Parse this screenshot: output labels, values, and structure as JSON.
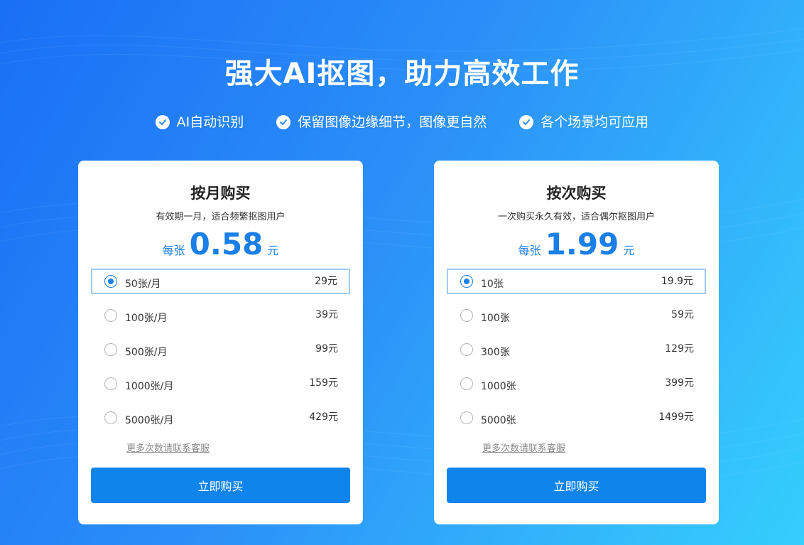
{
  "headline": "强大AI抠图，助力高效工作",
  "features": [
    {
      "icon": "check-circle-icon",
      "label": "AI自动识别"
    },
    {
      "icon": "check-circle-icon",
      "label": "保留图像边缘细节，图像更自然"
    },
    {
      "icon": "check-circle-icon",
      "label": "各个场景均可应用"
    }
  ],
  "plans": [
    {
      "title": "按月购买",
      "subtitle": "有效期一月，适合频繁抠图用户",
      "price_prefix": "每张",
      "price_value": "0.58",
      "price_unit": "元",
      "options": [
        {
          "label": "50张/月",
          "price": "29元",
          "selected": true
        },
        {
          "label": "100张/月",
          "price": "39元",
          "selected": false
        },
        {
          "label": "500张/月",
          "price": "99元",
          "selected": false
        },
        {
          "label": "1000张/月",
          "price": "159元",
          "selected": false
        },
        {
          "label": "5000张/月",
          "price": "429元",
          "selected": false
        }
      ],
      "more_link": "更多次数请联系客服",
      "buy_label": "立即购买"
    },
    {
      "title": "按次购买",
      "subtitle": "一次购买永久有效，适合偶尔抠图用户",
      "price_prefix": "每张",
      "price_value": "1.99",
      "price_unit": "元",
      "options": [
        {
          "label": "10张",
          "price": "19.9元",
          "selected": true
        },
        {
          "label": "100张",
          "price": "59元",
          "selected": false
        },
        {
          "label": "300张",
          "price": "129元",
          "selected": false
        },
        {
          "label": "1000张",
          "price": "399元",
          "selected": false
        },
        {
          "label": "5000张",
          "price": "1499元",
          "selected": false
        }
      ],
      "more_link": "更多次数请联系客服",
      "buy_label": "立即购买"
    }
  ],
  "colors": {
    "accent": "#1a7fe6",
    "button": "#0f84ea",
    "selected_border": "#9dcaf4",
    "bg_start": "#1a6ff5",
    "bg_end": "#35cffc"
  }
}
